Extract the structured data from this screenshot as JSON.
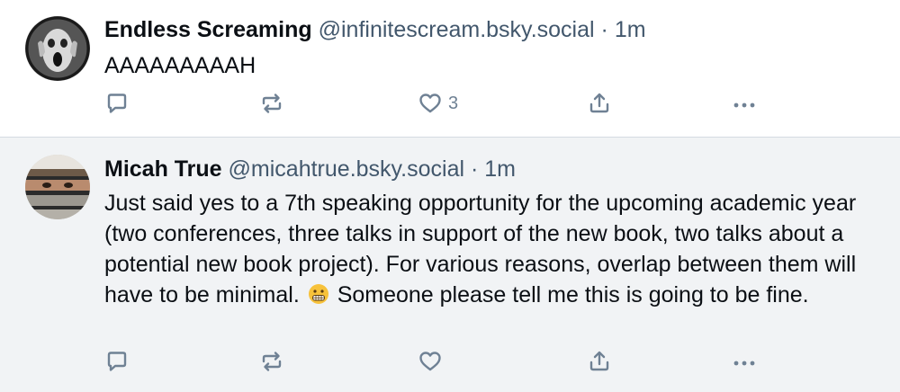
{
  "posts": [
    {
      "author_name": "Endless Screaming",
      "handle": "@infinitescream.bsky.social",
      "separator": "·",
      "time": "1m",
      "text": "AAAAAAAAAH",
      "like_count": "3",
      "icons": [
        "reply-icon",
        "repost-icon",
        "like-icon",
        "share-icon",
        "more-icon"
      ]
    },
    {
      "author_name": "Micah True",
      "handle": "@micahtrue.bsky.social",
      "separator": "·",
      "time": "1m",
      "text_before_emoji": "Just said yes to a 7th speaking opportunity for the upcoming academic year (two conferences, three talks in support of the new book, two talks about a potential new book project). For various reasons, overlap between them will have to be minimal.",
      "emoji": "grimacing-face-emoji",
      "text_after_emoji": "Someone please tell me this is going to be fine.",
      "icons": [
        "reply-icon",
        "repost-icon",
        "like-icon",
        "share-icon",
        "more-icon"
      ]
    }
  ],
  "colors": {
    "action_icon": "#6f8194",
    "handle": "#42576c",
    "highlight_bg": "#f1f3f5",
    "divider": "#d4dbe2"
  }
}
